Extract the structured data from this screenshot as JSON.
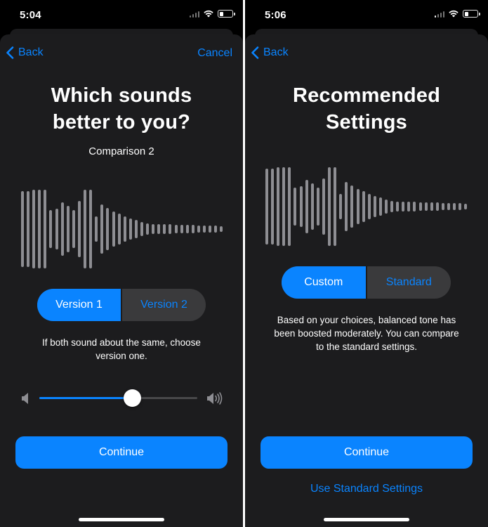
{
  "left": {
    "status": {
      "time": "5:04"
    },
    "nav": {
      "back": "Back",
      "cancel": "Cancel"
    },
    "title_line1": "Which sounds",
    "title_line2": "better to you?",
    "subtitle": "Comparison 2",
    "waveform_bars": [
      108,
      108,
      112,
      112,
      112,
      54,
      58,
      76,
      66,
      54,
      80,
      112,
      112,
      36,
      70,
      60,
      50,
      44,
      36,
      30,
      26,
      20,
      16,
      14,
      14,
      14,
      14,
      12,
      12,
      12,
      12,
      10,
      10,
      10,
      10,
      8
    ],
    "segments": {
      "option1": "Version 1",
      "option2": "Version 2",
      "selected": "option1"
    },
    "note_line1": "If both sound about the same, choose",
    "note_line2": "version one.",
    "volume": {
      "level": 0.59
    },
    "continue": "Continue"
  },
  "right": {
    "status": {
      "time": "5:06"
    },
    "nav": {
      "back": "Back"
    },
    "title_line1": "Recommended",
    "title_line2": "Settings",
    "waveform_bars": [
      108,
      108,
      112,
      112,
      112,
      54,
      58,
      76,
      66,
      54,
      80,
      112,
      112,
      36,
      70,
      60,
      50,
      44,
      36,
      30,
      26,
      20,
      16,
      14,
      14,
      14,
      14,
      12,
      12,
      12,
      12,
      10,
      10,
      10,
      10,
      8
    ],
    "segments": {
      "option1": "Custom",
      "option2": "Standard",
      "selected": "option1"
    },
    "note_line1": "Based on your choices, balanced tone has",
    "note_line2": "been boosted moderately. You can compare",
    "note_line3": "to the standard settings.",
    "continue": "Continue",
    "use_standard": "Use Standard Settings"
  },
  "colors": {
    "accent": "#0a84ff",
    "sheet": "#1c1c1e",
    "segment_off": "#3a3a3c",
    "waveform": "#8e8e93"
  }
}
